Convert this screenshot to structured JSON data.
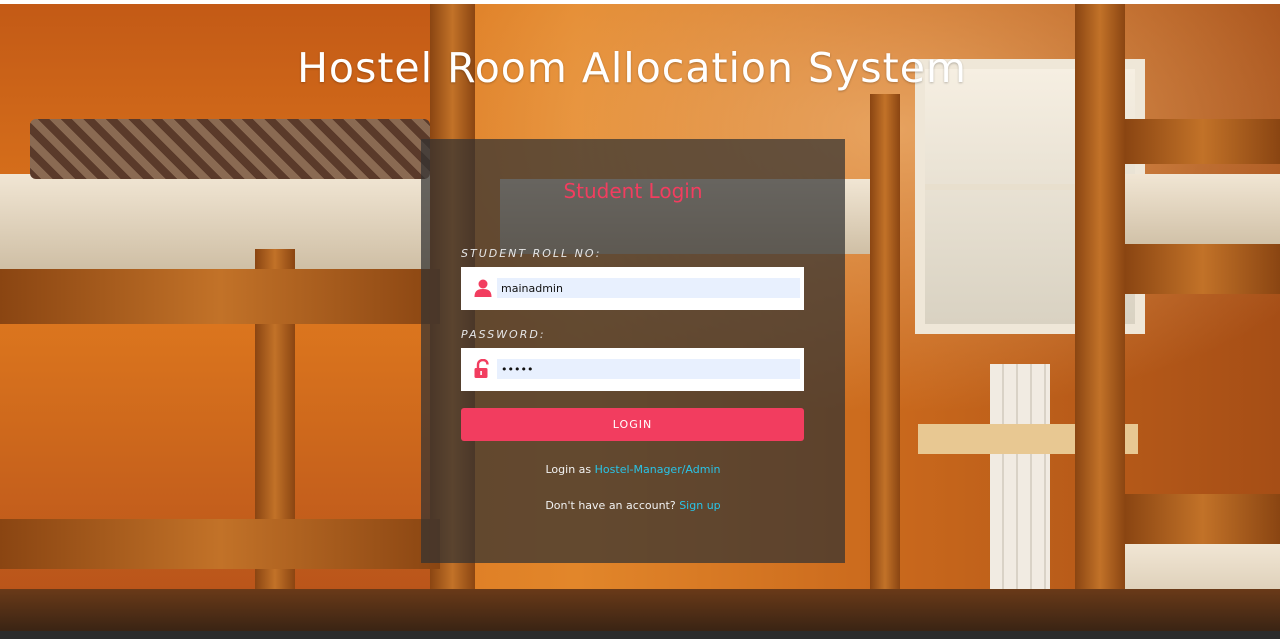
{
  "site": {
    "title": "Hostel Room Allocation System"
  },
  "login_form": {
    "heading": "Student Login",
    "roll_label": "STUDENT ROLL NO:",
    "roll_value": "mainadmin",
    "password_label": "PASSWORD:",
    "password_value": "admin",
    "submit_label": "LOGIN",
    "icons": {
      "roll": "user-icon",
      "password": "unlock-icon"
    }
  },
  "links": {
    "admin_prefix": "Login as",
    "admin_link": "Hostel-Manager/Admin",
    "signup_prefix": "Don't have an account?",
    "signup_link": "Sign up"
  },
  "colors": {
    "accent": "#f23d5f",
    "link": "#29c4e8",
    "panel": "#323232"
  }
}
